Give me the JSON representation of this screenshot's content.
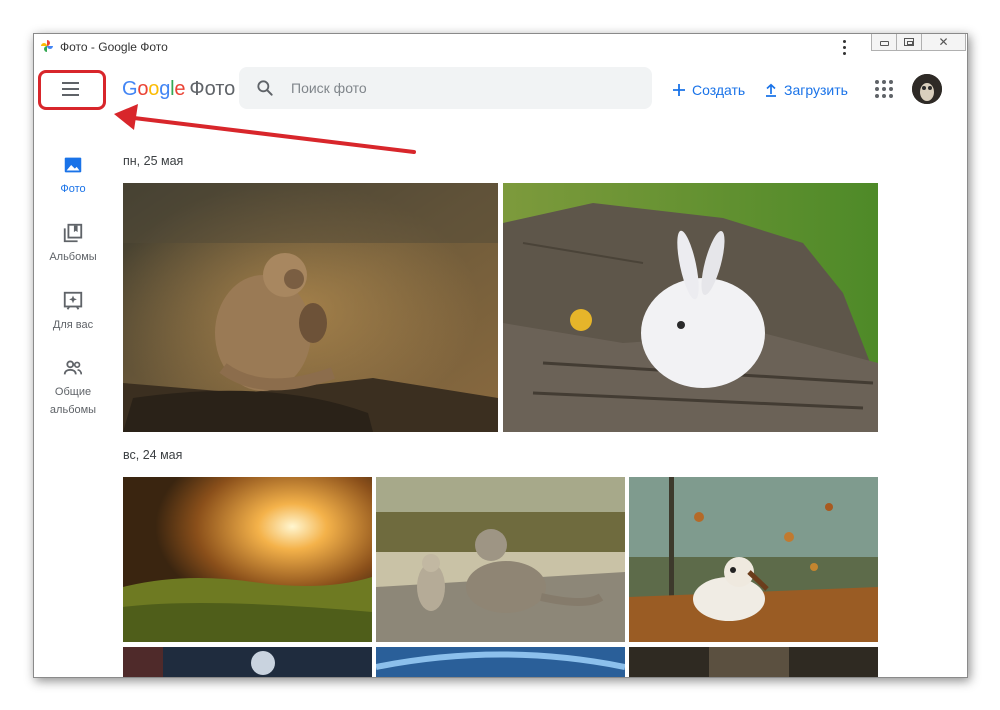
{
  "window": {
    "title": "Фото - Google Фото",
    "close_glyph": "✕"
  },
  "header": {
    "logo_google": "Google",
    "logo_product": "Фото",
    "search_placeholder": "Поиск фото",
    "create_label": "Создать",
    "upload_label": "Загрузить"
  },
  "sidebar": {
    "items": [
      {
        "label": "Фото",
        "icon": "photo-icon",
        "active": true
      },
      {
        "label": "Альбомы",
        "icon": "albums-icon",
        "active": false
      },
      {
        "label": "Для вас",
        "icon": "for-you-icon",
        "active": false
      },
      {
        "label": "Общие альбомы",
        "icon": "shared-albums-icon",
        "active": false
      }
    ]
  },
  "main": {
    "groups": [
      {
        "date": "пн, 25 мая",
        "photos": [
          "monkey",
          "rabbit"
        ]
      },
      {
        "date": "вс, 24 мая",
        "photos": [
          "sunset-grass",
          "cat-and-bird",
          "puppy-leaves",
          "partial-1",
          "partial-2",
          "partial-3"
        ]
      }
    ]
  },
  "annotation": {
    "highlight_color": "#d8262b"
  },
  "colors": {
    "accent": "#1a73e8",
    "text_secondary": "#5f6368",
    "search_bg": "#f1f3f4"
  }
}
